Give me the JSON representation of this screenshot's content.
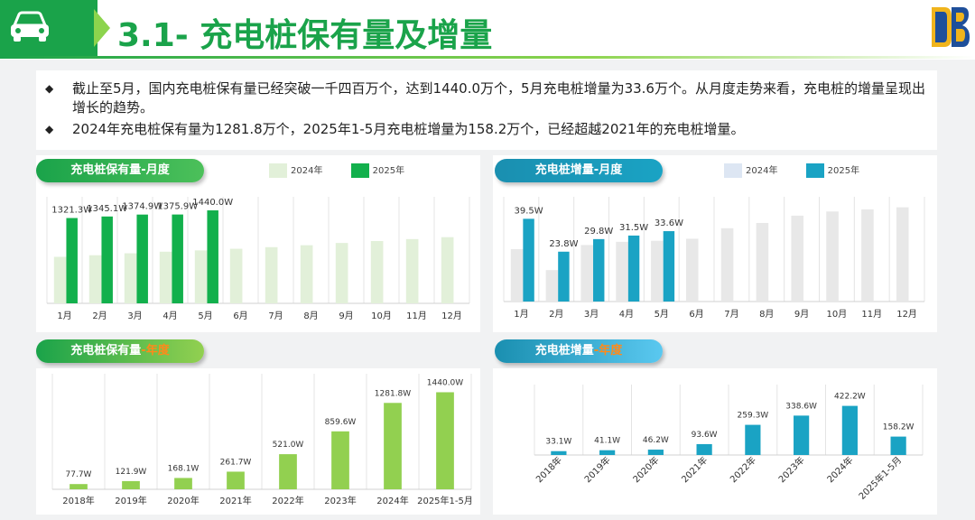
{
  "page": {
    "title": "3.1- 充电桩保有量及增量",
    "bullets": [
      "截止至5月，国内充电桩保有量已经突破一千四百万个，达到1440.0万个，5月充电桩增量为33.6万个。从月度走势来看，充电桩的增量呈现出增长的趋势。",
      "2024年充电桩保有量为1281.8万个，2025年1-5月充电桩增量为158.2万个，已经超越2021年的充电桩增量。"
    ],
    "bullet_symbol": "◆"
  },
  "chart_data": [
    {
      "type": "bar",
      "title": "充电桩保有量-月度",
      "categories": [
        "1月",
        "2月",
        "3月",
        "4月",
        "5月",
        "6月",
        "7月",
        "8月",
        "9月",
        "10月",
        "11月",
        "12月"
      ],
      "series": [
        {
          "name": "2024年",
          "color": "#e2f0d9",
          "values": [
            720,
            745,
            775,
            800,
            820,
            845,
            870,
            900,
            935,
            965,
            995,
            1025
          ]
        },
        {
          "name": "2025年",
          "color": "#12b04c",
          "values": [
            1321.3,
            1345.1,
            1374.9,
            1375.9,
            1440.0,
            null,
            null,
            null,
            null,
            null,
            null,
            null
          ],
          "labels": [
            "1321.3W",
            "1345.1W",
            "1374.9W",
            "1375.9W",
            "1440.0W"
          ]
        }
      ],
      "ylim": [
        0,
        1650
      ],
      "legend": "top"
    },
    {
      "type": "bar",
      "title": "充电桩增量-月度",
      "categories": [
        "1月",
        "2月",
        "3月",
        "4月",
        "5月",
        "6月",
        "7月",
        "8月",
        "9月",
        "10月",
        "11月",
        "12月"
      ],
      "series": [
        {
          "name": "2024年",
          "color": "#e8e8e8",
          "values": [
            25,
            15,
            27,
            28.5,
            29,
            30,
            35,
            37.5,
            41,
            43,
            44,
            45
          ]
        },
        {
          "name": "2025年",
          "color": "#1aa3c4",
          "values": [
            39.5,
            23.8,
            29.8,
            31.5,
            33.6,
            null,
            null,
            null,
            null,
            null,
            null,
            null
          ],
          "labels": [
            "39.5W",
            "23.8W",
            "29.8W",
            "31.5W",
            "33.6W"
          ]
        }
      ],
      "ylim": [
        0,
        50
      ],
      "legend": "top"
    },
    {
      "type": "bar",
      "title": "充电桩保有量-年度",
      "title_parts": [
        "充电桩保有量",
        "-年度"
      ],
      "categories": [
        "2018年",
        "2019年",
        "2020年",
        "2021年",
        "2022年",
        "2023年",
        "2024年",
        "2025年1-5月"
      ],
      "values": [
        77.7,
        121.9,
        168.1,
        261.7,
        521.0,
        859.6,
        1281.8,
        1440.0
      ],
      "labels": [
        "77.7W",
        "121.9W",
        "168.1W",
        "261.7W",
        "521.0W",
        "859.6W",
        "1281.8W",
        "1440.0W"
      ],
      "color": "#92d050",
      "ylim": [
        0,
        1500
      ]
    },
    {
      "type": "bar",
      "title": "充电桩增量-年度",
      "title_parts": [
        "充电桩增量",
        "-年度"
      ],
      "categories": [
        "2018年",
        "2019年",
        "2020年",
        "2021年",
        "2022年",
        "2023年",
        "2024年",
        "2025年1-5月"
      ],
      "values": [
        33.1,
        41.1,
        46.2,
        93.6,
        259.3,
        338.6,
        422.2,
        158.2
      ],
      "labels": [
        "33.1W",
        "41.1W",
        "46.2W",
        "93.6W",
        "259.3W",
        "338.6W",
        "422.2W",
        "158.2W"
      ],
      "color": "#1aa3c4",
      "ylim": [
        0,
        450
      ]
    }
  ],
  "colors": {
    "brand_green": "#1aa34a",
    "brand_teal": "#1aa3c4",
    "highlight": "#ff8a1a"
  },
  "icons": {
    "header": "car-icon",
    "logo": "db-logo-icon"
  }
}
